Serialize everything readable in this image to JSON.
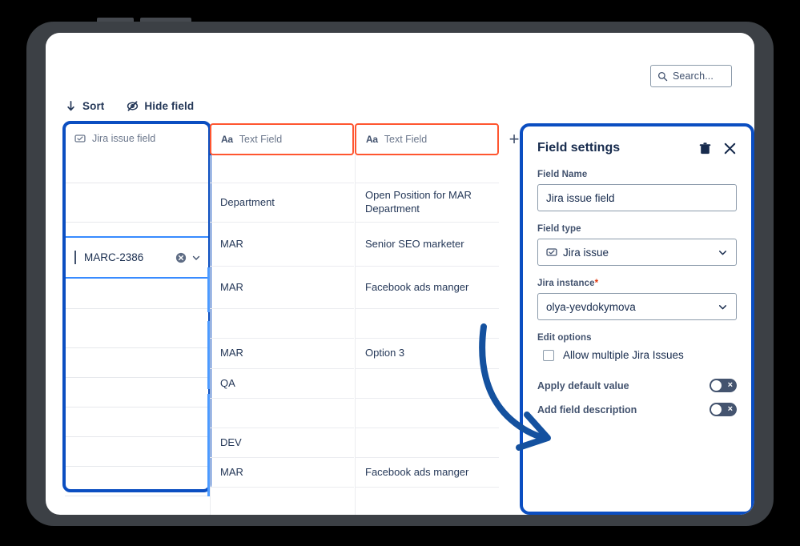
{
  "search": {
    "placeholder": "Search...",
    "icon": "search-icon"
  },
  "toolbar": {
    "sort_label": "Sort",
    "sort_icon": "arrow-down-icon",
    "hide_field_label": "Hide field",
    "hide_field_icon": "eye-slash-icon"
  },
  "grid": {
    "columns": [
      {
        "label": "Jira issue field",
        "icon": "jira-issue-icon",
        "highlight": "blue"
      },
      {
        "label": "Text Field",
        "icon": "text-field-icon",
        "highlight": "orange"
      },
      {
        "label": "Text Field",
        "icon": "text-field-icon",
        "highlight": "orange"
      }
    ],
    "add_column_label": "+",
    "col_a_cells": [
      "",
      "",
      "",
      "",
      "",
      "",
      "",
      "",
      ""
    ],
    "col_b_cells": [
      "",
      "Department",
      "MAR",
      "MAR",
      "",
      "MAR",
      "QA",
      "",
      "DEV",
      "MAR",
      ""
    ],
    "col_c_cells": [
      "",
      "Open Position for MAR Department",
      "Senior SEO marketer",
      "Facebook ads manger",
      "",
      "Option 3",
      "",
      "",
      "",
      "Facebook ads manger",
      ""
    ],
    "selected_cell": {
      "value": "MARC-2386",
      "clear_icon": "clear-circle-icon",
      "chevron_icon": "chevron-down-icon"
    }
  },
  "settings": {
    "title": "Field settings",
    "delete_icon": "trash-icon",
    "close_icon": "close-icon",
    "field_name_label": "Field Name",
    "field_name_value": "Jira issue field",
    "field_type_label": "Field type",
    "field_type_value": "Jira issue",
    "field_type_icon": "jira-issue-icon",
    "jira_instance_label": "Jira instance",
    "jira_instance_required": "*",
    "jira_instance_value": "olya-yevdokymova",
    "edit_options_label": "Edit options",
    "allow_multiple_label": "Allow multiple Jira Issues",
    "allow_multiple_checked": false,
    "apply_default_label": "Apply default value",
    "apply_default_on": false,
    "add_description_label": "Add field description",
    "add_description_on": false,
    "toggle_off_glyph": "×"
  },
  "annotation": {
    "type": "curved-arrow",
    "color": "#14519f"
  },
  "colors": {
    "accent_blue": "#0b4ec1",
    "orange": "#ff5630",
    "text": "#172b4d",
    "muted": "#6b778c",
    "frame": "#3c4045"
  }
}
